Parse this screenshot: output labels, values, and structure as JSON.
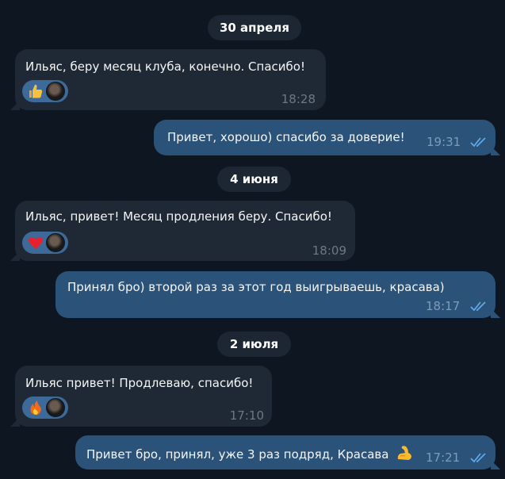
{
  "chat": {
    "dates": [
      "30 апреля",
      "4 июня",
      "2 июля"
    ],
    "messages": [
      {
        "text": "Ильяс, беру месяц клуба, конечно. Спасибо!",
        "time": "18:28",
        "reaction": "thumbs-up-icon"
      },
      {
        "text": "Привет, хорошо) спасибо за доверие!",
        "time": "19:31"
      },
      {
        "text": "Ильяс, привет! Месяц продления беру. Спасибо!",
        "time": "18:09",
        "reaction": "heart-icon"
      },
      {
        "text": "Принял бро) второй раз за этот год выигрываешь, красава)",
        "time": "18:17"
      },
      {
        "text": "Ильяс привет! Продлеваю, спасибо!",
        "time": "17:10",
        "reaction": "fire-icon"
      },
      {
        "text": "Привет бро, принял, уже 3 раз подряд, Красава",
        "time": "17:21",
        "trailing_icon": "flexed-biceps-icon"
      }
    ]
  },
  "colors": {
    "background": "#0e1621",
    "incoming_bubble": "#1f2936",
    "outgoing_bubble": "#2b5278",
    "date_pill": "#1c2733",
    "reaction_pill": "#3e6a99",
    "read_checks": "#5fa8e8"
  }
}
